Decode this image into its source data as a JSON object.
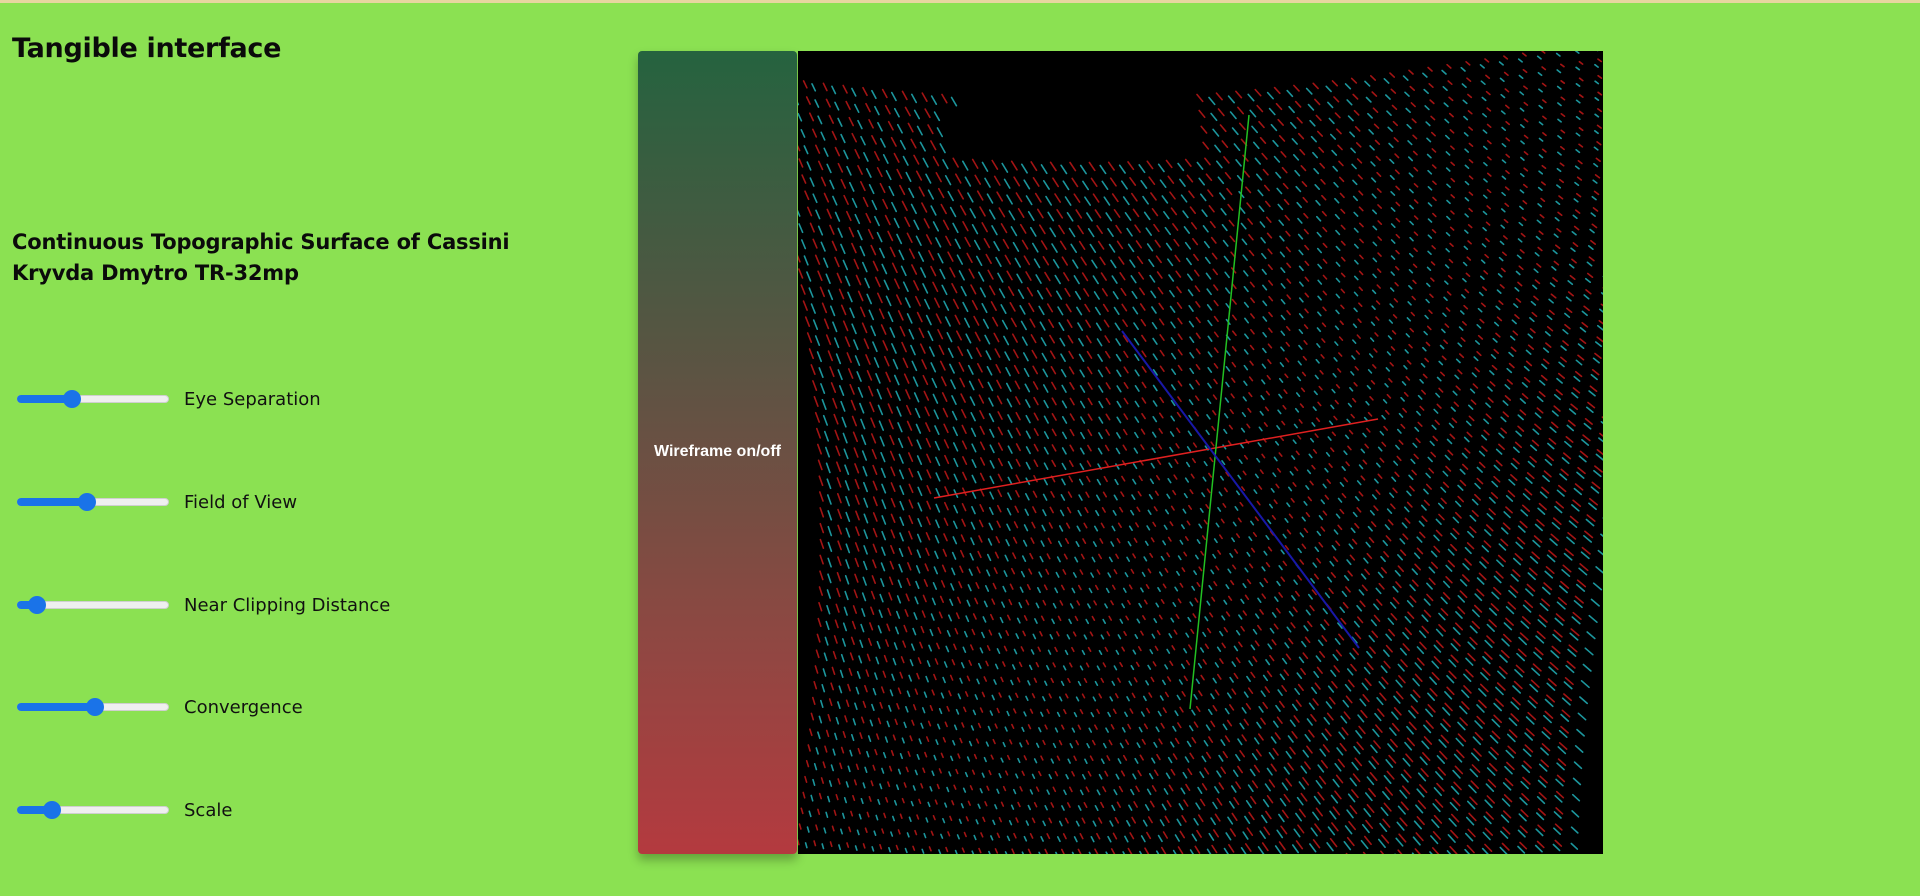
{
  "header": {
    "title": "Tangible interface"
  },
  "info": {
    "line1": "Continuous Topographic Surface of Cassini",
    "line2": "Kryvda Dmytro TR-32mp"
  },
  "controls": [
    {
      "label": "Eye Separation",
      "value_fraction": 0.36
    },
    {
      "label": "Field of View",
      "value_fraction": 0.46
    },
    {
      "label": "Near Clipping Distance",
      "value_fraction": 0.13
    },
    {
      "label": "Convergence",
      "value_fraction": 0.51
    },
    {
      "label": "Scale",
      "value_fraction": 0.23
    }
  ],
  "wireframe_button": {
    "label": "Wireframe on/off"
  },
  "scene": {
    "background": "#000000",
    "left_eye_color": "#b51616",
    "right_eye_color": "#1fa6ae",
    "axis_x_color": "#e02020",
    "axis_y_color": "#22c022",
    "axis_z_color": "#1818a8"
  },
  "colors": {
    "page_background": "#8be152",
    "slider_accent": "#1a73e8",
    "button_top": "#25633f",
    "button_bottom": "#b43a3f"
  }
}
